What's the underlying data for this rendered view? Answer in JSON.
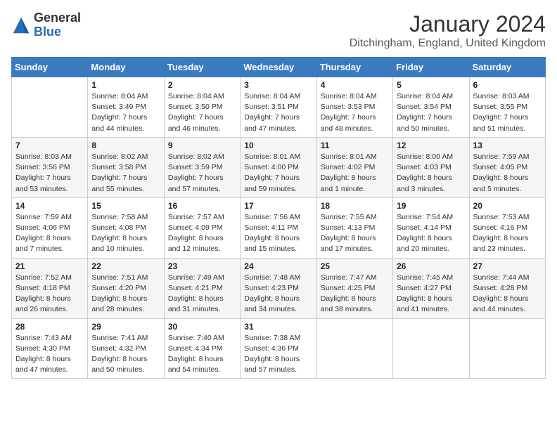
{
  "logo": {
    "general": "General",
    "blue": "Blue"
  },
  "title": "January 2024",
  "location": "Ditchingham, England, United Kingdom",
  "days_of_week": [
    "Sunday",
    "Monday",
    "Tuesday",
    "Wednesday",
    "Thursday",
    "Friday",
    "Saturday"
  ],
  "weeks": [
    [
      {
        "day": "",
        "sunrise": "",
        "sunset": "",
        "daylight": ""
      },
      {
        "day": "1",
        "sunrise": "Sunrise: 8:04 AM",
        "sunset": "Sunset: 3:49 PM",
        "daylight": "Daylight: 7 hours and 44 minutes."
      },
      {
        "day": "2",
        "sunrise": "Sunrise: 8:04 AM",
        "sunset": "Sunset: 3:50 PM",
        "daylight": "Daylight: 7 hours and 46 minutes."
      },
      {
        "day": "3",
        "sunrise": "Sunrise: 8:04 AM",
        "sunset": "Sunset: 3:51 PM",
        "daylight": "Daylight: 7 hours and 47 minutes."
      },
      {
        "day": "4",
        "sunrise": "Sunrise: 8:04 AM",
        "sunset": "Sunset: 3:53 PM",
        "daylight": "Daylight: 7 hours and 48 minutes."
      },
      {
        "day": "5",
        "sunrise": "Sunrise: 8:04 AM",
        "sunset": "Sunset: 3:54 PM",
        "daylight": "Daylight: 7 hours and 50 minutes."
      },
      {
        "day": "6",
        "sunrise": "Sunrise: 8:03 AM",
        "sunset": "Sunset: 3:55 PM",
        "daylight": "Daylight: 7 hours and 51 minutes."
      }
    ],
    [
      {
        "day": "7",
        "sunrise": "Sunrise: 8:03 AM",
        "sunset": "Sunset: 3:56 PM",
        "daylight": "Daylight: 7 hours and 53 minutes."
      },
      {
        "day": "8",
        "sunrise": "Sunrise: 8:02 AM",
        "sunset": "Sunset: 3:58 PM",
        "daylight": "Daylight: 7 hours and 55 minutes."
      },
      {
        "day": "9",
        "sunrise": "Sunrise: 8:02 AM",
        "sunset": "Sunset: 3:59 PM",
        "daylight": "Daylight: 7 hours and 57 minutes."
      },
      {
        "day": "10",
        "sunrise": "Sunrise: 8:01 AM",
        "sunset": "Sunset: 4:00 PM",
        "daylight": "Daylight: 7 hours and 59 minutes."
      },
      {
        "day": "11",
        "sunrise": "Sunrise: 8:01 AM",
        "sunset": "Sunset: 4:02 PM",
        "daylight": "Daylight: 8 hours and 1 minute."
      },
      {
        "day": "12",
        "sunrise": "Sunrise: 8:00 AM",
        "sunset": "Sunset: 4:03 PM",
        "daylight": "Daylight: 8 hours and 3 minutes."
      },
      {
        "day": "13",
        "sunrise": "Sunrise: 7:59 AM",
        "sunset": "Sunset: 4:05 PM",
        "daylight": "Daylight: 8 hours and 5 minutes."
      }
    ],
    [
      {
        "day": "14",
        "sunrise": "Sunrise: 7:59 AM",
        "sunset": "Sunset: 4:06 PM",
        "daylight": "Daylight: 8 hours and 7 minutes."
      },
      {
        "day": "15",
        "sunrise": "Sunrise: 7:58 AM",
        "sunset": "Sunset: 4:08 PM",
        "daylight": "Daylight: 8 hours and 10 minutes."
      },
      {
        "day": "16",
        "sunrise": "Sunrise: 7:57 AM",
        "sunset": "Sunset: 4:09 PM",
        "daylight": "Daylight: 8 hours and 12 minutes."
      },
      {
        "day": "17",
        "sunrise": "Sunrise: 7:56 AM",
        "sunset": "Sunset: 4:11 PM",
        "daylight": "Daylight: 8 hours and 15 minutes."
      },
      {
        "day": "18",
        "sunrise": "Sunrise: 7:55 AM",
        "sunset": "Sunset: 4:13 PM",
        "daylight": "Daylight: 8 hours and 17 minutes."
      },
      {
        "day": "19",
        "sunrise": "Sunrise: 7:54 AM",
        "sunset": "Sunset: 4:14 PM",
        "daylight": "Daylight: 8 hours and 20 minutes."
      },
      {
        "day": "20",
        "sunrise": "Sunrise: 7:53 AM",
        "sunset": "Sunset: 4:16 PM",
        "daylight": "Daylight: 8 hours and 23 minutes."
      }
    ],
    [
      {
        "day": "21",
        "sunrise": "Sunrise: 7:52 AM",
        "sunset": "Sunset: 4:18 PM",
        "daylight": "Daylight: 8 hours and 26 minutes."
      },
      {
        "day": "22",
        "sunrise": "Sunrise: 7:51 AM",
        "sunset": "Sunset: 4:20 PM",
        "daylight": "Daylight: 8 hours and 28 minutes."
      },
      {
        "day": "23",
        "sunrise": "Sunrise: 7:49 AM",
        "sunset": "Sunset: 4:21 PM",
        "daylight": "Daylight: 8 hours and 31 minutes."
      },
      {
        "day": "24",
        "sunrise": "Sunrise: 7:48 AM",
        "sunset": "Sunset: 4:23 PM",
        "daylight": "Daylight: 8 hours and 34 minutes."
      },
      {
        "day": "25",
        "sunrise": "Sunrise: 7:47 AM",
        "sunset": "Sunset: 4:25 PM",
        "daylight": "Daylight: 8 hours and 38 minutes."
      },
      {
        "day": "26",
        "sunrise": "Sunrise: 7:45 AM",
        "sunset": "Sunset: 4:27 PM",
        "daylight": "Daylight: 8 hours and 41 minutes."
      },
      {
        "day": "27",
        "sunrise": "Sunrise: 7:44 AM",
        "sunset": "Sunset: 4:28 PM",
        "daylight": "Daylight: 8 hours and 44 minutes."
      }
    ],
    [
      {
        "day": "28",
        "sunrise": "Sunrise: 7:43 AM",
        "sunset": "Sunset: 4:30 PM",
        "daylight": "Daylight: 8 hours and 47 minutes."
      },
      {
        "day": "29",
        "sunrise": "Sunrise: 7:41 AM",
        "sunset": "Sunset: 4:32 PM",
        "daylight": "Daylight: 8 hours and 50 minutes."
      },
      {
        "day": "30",
        "sunrise": "Sunrise: 7:40 AM",
        "sunset": "Sunset: 4:34 PM",
        "daylight": "Daylight: 8 hours and 54 minutes."
      },
      {
        "day": "31",
        "sunrise": "Sunrise: 7:38 AM",
        "sunset": "Sunset: 4:36 PM",
        "daylight": "Daylight: 8 hours and 57 minutes."
      },
      {
        "day": "",
        "sunrise": "",
        "sunset": "",
        "daylight": ""
      },
      {
        "day": "",
        "sunrise": "",
        "sunset": "",
        "daylight": ""
      },
      {
        "day": "",
        "sunrise": "",
        "sunset": "",
        "daylight": ""
      }
    ]
  ]
}
